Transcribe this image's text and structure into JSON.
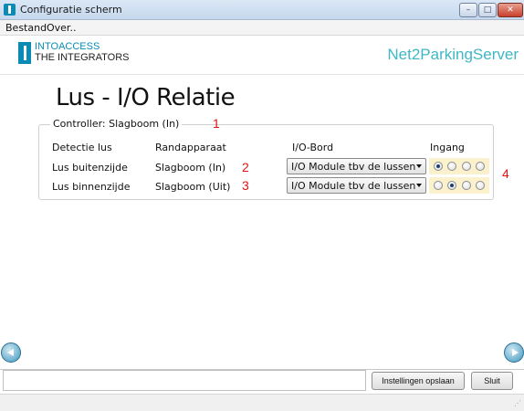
{
  "window": {
    "title": "Configuratie scherm",
    "minimize": "–",
    "maximize": "□",
    "close": "✕"
  },
  "menu": {
    "items": [
      "Bestand",
      "Over.."
    ]
  },
  "header": {
    "logo_top": "INTOACCESS",
    "logo_bottom": "THE INTEGRATORS",
    "product": "Net2ParkingServer"
  },
  "page": {
    "title": "Lus - I/O Relatie"
  },
  "group": {
    "legend": "Controller: Slagboom (In)"
  },
  "table": {
    "headers": {
      "detectie": "Detectie lus",
      "randapparaat": "Randapparaat",
      "io_bord": "I/O-Bord",
      "ingang": "Ingang"
    },
    "rows": [
      {
        "lus": "Lus buitenzijde",
        "randapparaat": "Slagboom (In)",
        "io_bord": "I/O Module tbv de lussen",
        "ingang_selected": 1,
        "ingang_count": 4
      },
      {
        "lus": "Lus binnenzijde",
        "randapparaat": "Slagboom (Uit)",
        "io_bord": "I/O Module tbv de lussen",
        "ingang_selected": 2,
        "ingang_count": 4
      }
    ]
  },
  "annotations": {
    "a1": "1",
    "a2": "2",
    "a3": "3",
    "a4": "4",
    "color": "#e01515"
  },
  "buttons": {
    "save": "Instellingen opslaan",
    "close": "Sluit"
  },
  "statusbar": {
    "grip": "⋰"
  },
  "colors": {
    "brand": "#0a8bb5",
    "product": "#3fb7c4",
    "radio_bg": "#fbf1cc"
  }
}
